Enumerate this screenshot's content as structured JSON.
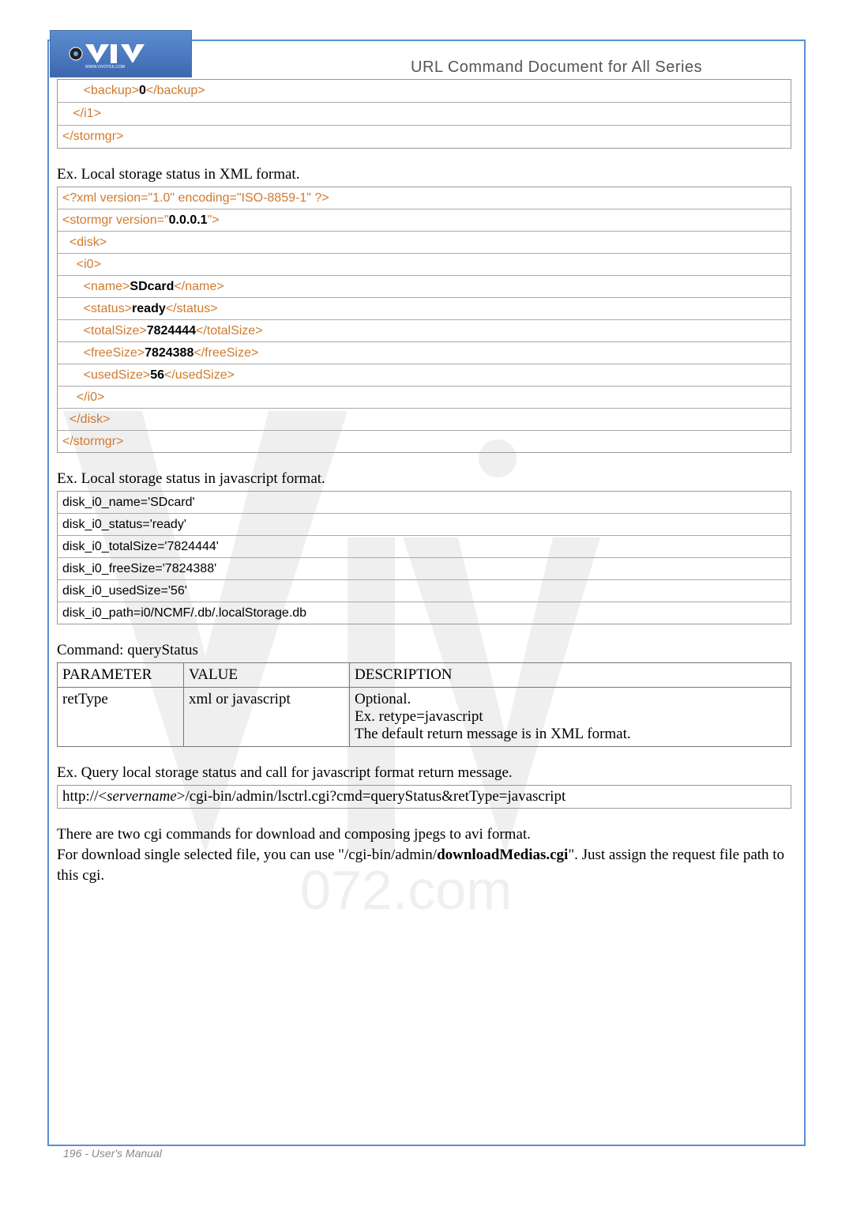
{
  "header": {
    "title": "URL Command Document for All Series"
  },
  "box1": {
    "r1_pre": "      <backup>",
    "r1_val": "0",
    "r1_post": "</backup>",
    "r2": "   </i1>",
    "r3": "</stormgr>"
  },
  "ex1_label": "Ex. Local storage status in XML format.",
  "box2": {
    "r1": "<?xml version=\"1.0\" encoding=\"ISO-8859-1\" ?>",
    "r2_pre": "<stormgr version=\"",
    "r2_val": "0.0.0.1",
    "r2_post": "\">",
    "r3": "  <disk>",
    "r4": "    <i0>",
    "r5_pre": "      <name>",
    "r5_val": "SDcard",
    "r5_post": "</name>",
    "r6_pre": "      <status>",
    "r6_val": "ready",
    "r6_post": "</status>",
    "r7_pre": "      <totalSize>",
    "r7_val": "7824444",
    "r7_post": "</totalSize>",
    "r8_pre": "      <freeSize>",
    "r8_val": "7824388",
    "r8_post": "</freeSize>",
    "r9_pre": "      <usedSize>",
    "r9_val": "56",
    "r9_post": "</usedSize>",
    "r10": "    </i0>",
    "r11": "  </disk>",
    "r12": "</stormgr>"
  },
  "ex2_label": "Ex. Local storage status in javascript format.",
  "box3": {
    "r1": "disk_i0_name='SDcard'",
    "r2": "disk_i0_status='ready'",
    "r3": "disk_i0_totalSize='7824444'",
    "r4": "disk_i0_freeSize='7824388'",
    "r5": "disk_i0_usedSize='56'",
    "r6": "disk_i0_path=i0/NCMF/.db/.localStorage.db"
  },
  "cmd_label": "Command: queryStatus",
  "table": {
    "h1": "PARAMETER",
    "h2": "VALUE",
    "h3": "DESCRIPTION",
    "p1": "retType",
    "v1": "xml or javascript",
    "d1a": "Optional.",
    "d1b": "Ex. retype=javascript",
    "d1c": "The default return message is in XML format."
  },
  "ex3_label": "Ex. Query local storage status and call for javascript format return message.",
  "box4_pre": "http://<",
  "box4_srv": "servername",
  "box4_post": ">/cgi-bin/admin/lsctrl.cgi?cmd=queryStatus&retType=javascript",
  "body1": "There are two cgi commands for download and composing jpegs to avi format.",
  "body2_pre": "For download single selected file, you can use \"/cgi-bin/admin/",
  "body2_bold": "downloadMedias.cgi",
  "body2_post": "\". Just assign the request file path to this cgi.",
  "footer": "196 - User's Manual"
}
